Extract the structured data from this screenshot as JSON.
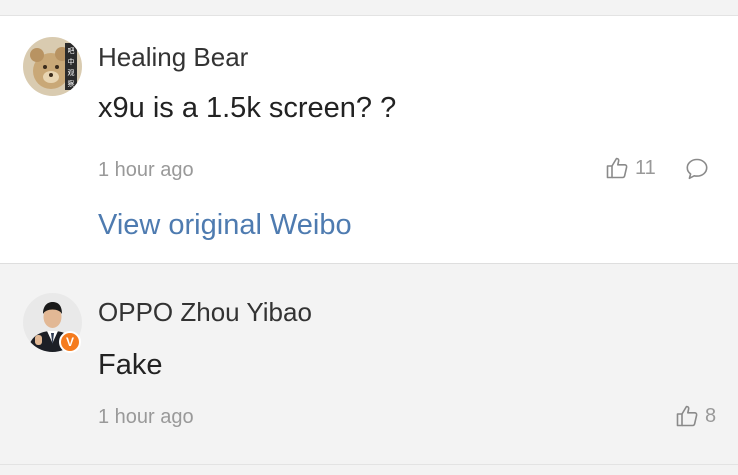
{
  "comments": [
    {
      "username": "Healing Bear",
      "text": "x9u is a 1.5k screen? ?",
      "time": "1 hour ago",
      "likes": "11",
      "view_original": "View original Weibo",
      "avatar_lettering": "吧中观察"
    },
    {
      "username": "OPPO Zhou Yibao",
      "text": "Fake",
      "time": "1 hour ago",
      "likes": "8",
      "verified_mark": "V"
    }
  ],
  "colors": {
    "link": "#4e7bb0",
    "verified_badge": "#f57b1e",
    "muted_text": "#999999",
    "primary_text": "#222222"
  }
}
